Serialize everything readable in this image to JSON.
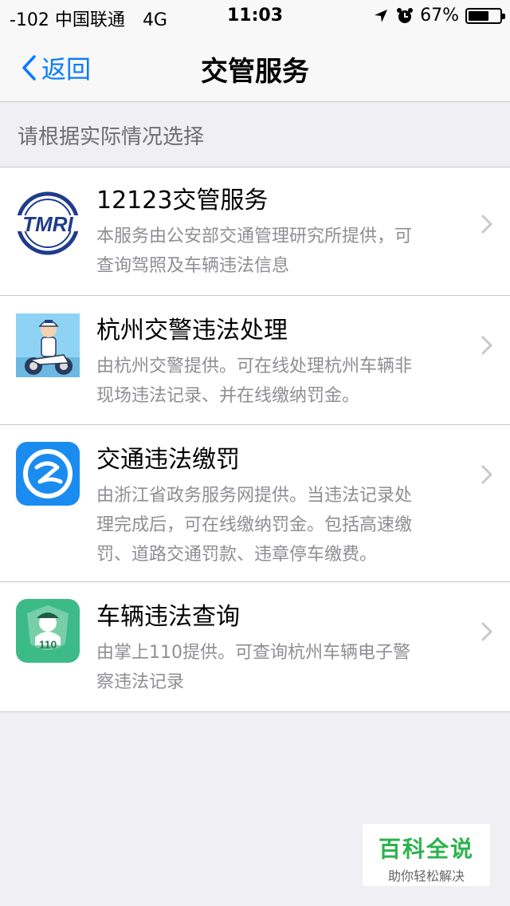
{
  "status_bar": {
    "carrier": "-102 中国联通",
    "network": "4G",
    "time": "11:03",
    "battery": "67%",
    "battery_level": 0.67,
    "icons": [
      "location-arrow-icon",
      "alarm-clock-icon",
      "battery-icon"
    ]
  },
  "nav": {
    "back_label": "返回",
    "title": "交管服务"
  },
  "section_header": "请根据实际情况选择",
  "services": [
    {
      "title": "12123交管服务",
      "desc_lines": [
        "本服务由公安部交通管理研究所提供，可",
        "查询驾照及车辆违法信息"
      ],
      "icon": "tmri-logo-icon",
      "icon_text": "TMRI"
    },
    {
      "title": "杭州交警违法处理",
      "desc_lines": [
        "由杭州交警提供。可在线处理杭州车辆非",
        "现场违法记录、并在线缴纳罚金。"
      ],
      "icon": "traffic-police-motorcycle-icon"
    },
    {
      "title": "交通违法缴罚",
      "desc_lines": [
        "由浙江省政务服务网提供。当违法记录处",
        "理完成后，可在线缴纳罚金。包括高速缴",
        "罚、道路交通罚款、违章停车缴费。"
      ],
      "icon": "zhejiang-gov-service-icon"
    },
    {
      "title": "车辆违法查询",
      "desc_lines": [
        "由掌上110提供。可查询杭州车辆电子警",
        "察违法记录"
      ],
      "icon": "police-110-badge-icon",
      "icon_text": "110"
    }
  ],
  "watermark": {
    "main": "百科全说",
    "sub": "助你轻松解决"
  },
  "colors": {
    "accent": "#0a7aff",
    "background": "#efeff4",
    "watermark_green": "#2bb24c"
  }
}
